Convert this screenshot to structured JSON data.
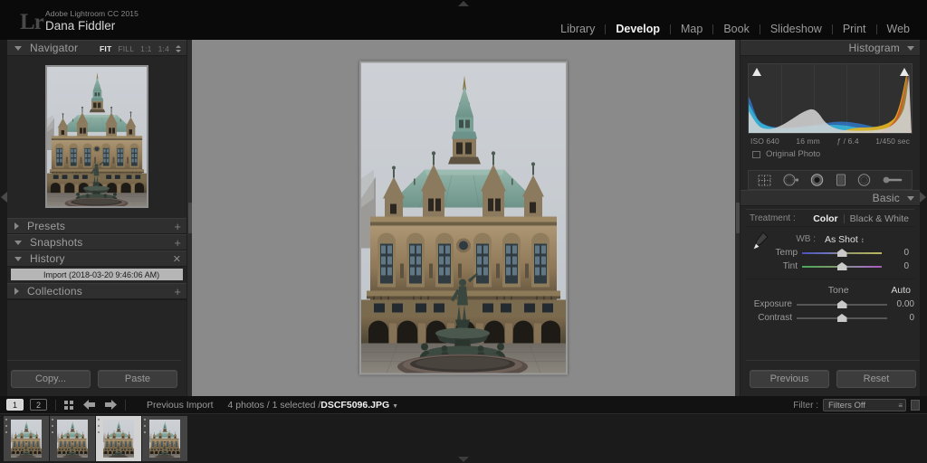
{
  "app": {
    "logo": "Lr",
    "product": "Adobe Lightroom CC 2015",
    "user": "Dana Fiddler"
  },
  "modules": [
    {
      "label": "Library",
      "active": false
    },
    {
      "label": "Develop",
      "active": true
    },
    {
      "label": "Map",
      "active": false
    },
    {
      "label": "Book",
      "active": false
    },
    {
      "label": "Slideshow",
      "active": false
    },
    {
      "label": "Print",
      "active": false
    },
    {
      "label": "Web",
      "active": false
    }
  ],
  "left_panel": {
    "navigator": {
      "title": "Navigator",
      "zoom_levels": [
        {
          "label": "FIT",
          "active": true
        },
        {
          "label": "FILL",
          "active": false
        },
        {
          "label": "1:1",
          "active": false
        },
        {
          "label": "1:4",
          "active": false
        }
      ]
    },
    "presets": {
      "title": "Presets",
      "add": "+"
    },
    "snapshots": {
      "title": "Snapshots",
      "add": "+"
    },
    "history": {
      "title": "History",
      "clear": "✕",
      "items": [
        "Import (2018-03-20 9:46:06 AM)"
      ]
    },
    "collections": {
      "title": "Collections",
      "add": "+"
    },
    "buttons": {
      "copy": "Copy...",
      "paste": "Paste"
    }
  },
  "right_panel": {
    "histogram": {
      "title": "Histogram",
      "exif": {
        "iso": "ISO 640",
        "focal": "16 mm",
        "aperture": "ƒ / 6.4",
        "shutter": "1/450 sec"
      },
      "original_photo": "Original Photo"
    },
    "tools": [
      "crop-overlay-icon",
      "spot-removal-icon",
      "red-eye-correction-icon",
      "graduated-filter-icon",
      "radial-filter-icon",
      "adjustment-brush-icon"
    ],
    "basic": {
      "title": "Basic",
      "treatment_label": "Treatment :",
      "treatment_options": [
        {
          "label": "Color",
          "active": true
        },
        {
          "label": "Black & White",
          "active": false
        }
      ],
      "wb_label": "WB :",
      "wb_value": "As Shot",
      "sliders": [
        {
          "name": "Temp",
          "value": "0",
          "pos": 50
        },
        {
          "name": "Tint",
          "value": "0",
          "pos": 50
        }
      ],
      "tone_label": "Tone",
      "auto_label": "Auto",
      "tone_sliders": [
        {
          "name": "Exposure",
          "value": "0.00",
          "pos": 50
        },
        {
          "name": "Contrast",
          "value": "0",
          "pos": 50
        }
      ]
    },
    "buttons": {
      "previous": "Previous",
      "reset": "Reset"
    }
  },
  "filmstrip": {
    "monitors": [
      {
        "label": "1",
        "active": true
      },
      {
        "label": "2",
        "active": false
      }
    ],
    "source": "Previous Import",
    "count": "4 photos / 1 selected /",
    "filename": "DSCF5096.JPG",
    "filter_label": "Filter :",
    "filter_value": "Filters Off",
    "thumbnails": [
      {
        "selected": false
      },
      {
        "selected": false
      },
      {
        "selected": true
      },
      {
        "selected": false
      }
    ]
  },
  "colors": {
    "chrome_dark": "#1a1a1a",
    "panel": "#252525",
    "canvas": "#8a8a8a",
    "text": "#b4b4b4",
    "text_active": "#f2f2f2",
    "histogram_highlight": "#e8d24a"
  },
  "photo": {
    "subject": "Hamburg Rathaus courtyard with Hygieia Fountain",
    "sky": "#c9ccd0",
    "roof": "#7fa79c",
    "stone": "#a08a6a",
    "bronze": "#3a4a42"
  }
}
